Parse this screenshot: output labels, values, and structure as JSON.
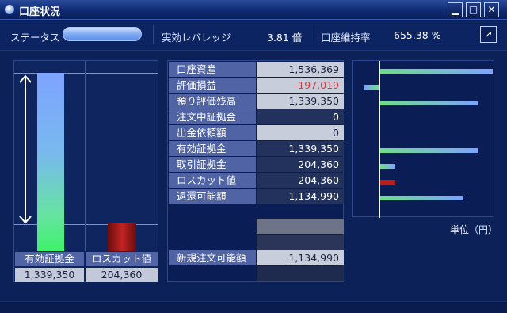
{
  "window": {
    "title": "口座状況",
    "minimize_label": "▁",
    "maximize_label": "□",
    "close_label": "✕"
  },
  "status": {
    "label": "ステータス",
    "leverage_label": "実効レバレッジ",
    "leverage_value": "3.81 倍",
    "maintenance_label": "口座維持率",
    "maintenance_value": "655.38 %",
    "popout_label": "↗"
  },
  "gauge": {
    "green_label": "有効証拠金",
    "green_value": "1,339,350",
    "red_label": "ロスカット値",
    "red_value": "204,360",
    "colors": {
      "green_top": "#7ea3ff",
      "green_bottom": "#3ef26b",
      "red": "#c22323"
    }
  },
  "table": {
    "rows": [
      {
        "label": "口座資産",
        "value": "1,536,369",
        "style": "light"
      },
      {
        "label": "評価損益",
        "value": "-197,019",
        "style": "light-neg"
      },
      {
        "label": "預り評価残高",
        "value": "1,339,350",
        "style": "light"
      },
      {
        "label": "注文中証拠金",
        "value": "0",
        "style": "dark"
      },
      {
        "label": "出金依頼額",
        "value": "0",
        "style": "light"
      },
      {
        "label": "有効証拠金",
        "value": "1,339,350",
        "style": "dark"
      },
      {
        "label": "取引証拠金",
        "value": "204,360",
        "style": "dark"
      },
      {
        "label": "ロスカット値",
        "value": "204,360",
        "style": "dark"
      },
      {
        "label": "返還可能額",
        "value": "1,134,990",
        "style": "dark"
      }
    ],
    "new_order": {
      "label": "新規注文可能額",
      "value": "1,134,990"
    }
  },
  "chart_data": {
    "type": "bar",
    "orientation": "horizontal",
    "categories": [
      "口座資産",
      "評価損益",
      "預り評価残高",
      "注文中証拠金",
      "出金依頼額",
      "有効証拠金",
      "取引証拠金",
      "ロスカット値",
      "返還可能額"
    ],
    "values": [
      1536369,
      -197019,
      1339350,
      0,
      0,
      1339350,
      204360,
      204360,
      1134990
    ],
    "unit_label": "単位（円）",
    "colors": {
      "default": "#6fdc8a",
      "accent": "#7ea3ff",
      "red": "#b32020"
    }
  }
}
